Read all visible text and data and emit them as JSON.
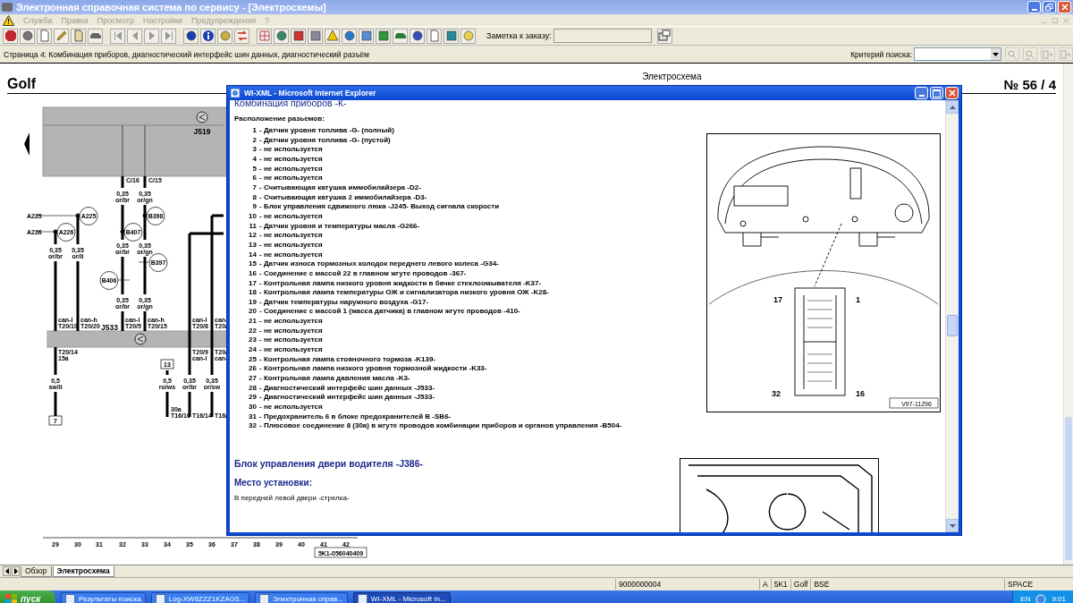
{
  "window": {
    "title": "Электронная справочная система по сервису - [Электросхемы]"
  },
  "menu": [
    "Служба",
    "Правка",
    "Просмотр",
    "Настройки",
    "Предупреждения",
    "?"
  ],
  "toolbar": {
    "note_label": "Заметка к заказу:"
  },
  "page_bar": {
    "page_text": "Страница 4: Комбинация приборов, диагностический интерфейс шин данных, диагностический разъём",
    "search_label": "Критерий поиска:"
  },
  "document": {
    "model": "Golf",
    "title": "Электросхема",
    "page_number": "№ 56 / 4",
    "part_number": "5K1-056040409",
    "column_numbers": [
      "29",
      "30",
      "31",
      "32",
      "33",
      "34",
      "35",
      "36",
      "37",
      "38",
      "39",
      "40",
      "41",
      "42"
    ],
    "schematic_labels": [
      {
        "kind": "unit",
        "text": "J519"
      },
      {
        "kind": "text",
        "text": "C/16"
      },
      {
        "kind": "text",
        "text": "C/15"
      },
      {
        "kind": "text",
        "text": "0,35"
      },
      {
        "kind": "text",
        "text": "or/br"
      },
      {
        "kind": "text",
        "text": "0,35"
      },
      {
        "kind": "text",
        "text": "or/gn"
      },
      {
        "kind": "text",
        "text": "A225"
      },
      {
        "kind": "circle",
        "text": "A225"
      },
      {
        "kind": "text",
        "text": "A226"
      },
      {
        "kind": "circle",
        "text": "A226"
      },
      {
        "kind": "circle",
        "text": "B398"
      },
      {
        "kind": "circle",
        "text": "B407"
      },
      {
        "kind": "text",
        "text": "0,35"
      },
      {
        "kind": "text",
        "text": "or/br"
      },
      {
        "kind": "text",
        "text": "0,35"
      },
      {
        "kind": "text",
        "text": "or/li"
      },
      {
        "kind": "text",
        "text": "0,35"
      },
      {
        "kind": "text",
        "text": "or/br"
      },
      {
        "kind": "text",
        "text": "0,35"
      },
      {
        "kind": "text",
        "text": "or/gn"
      },
      {
        "kind": "circle",
        "text": "B397"
      },
      {
        "kind": "circle",
        "text": "B406"
      },
      {
        "kind": "text",
        "text": "0,35"
      },
      {
        "kind": "text",
        "text": "or/br"
      },
      {
        "kind": "text",
        "text": "0,35"
      },
      {
        "kind": "text",
        "text": "or/gn"
      },
      {
        "kind": "text",
        "text": "can-l"
      },
      {
        "kind": "text",
        "text": "T20/10"
      },
      {
        "kind": "text",
        "text": "can-h"
      },
      {
        "kind": "text",
        "text": "T20/20"
      },
      {
        "kind": "unit",
        "text": "J533"
      },
      {
        "kind": "text",
        "text": "can-l"
      },
      {
        "kind": "text",
        "text": "T20/5"
      },
      {
        "kind": "text",
        "text": "can-h"
      },
      {
        "kind": "text",
        "text": "T20/15"
      },
      {
        "kind": "text",
        "text": "can-l"
      },
      {
        "kind": "text",
        "text": "T20/8"
      },
      {
        "kind": "text",
        "text": "can-"
      },
      {
        "kind": "text",
        "text": "T20/"
      },
      {
        "kind": "text",
        "text": "T20/14"
      },
      {
        "kind": "text",
        "text": "15a"
      },
      {
        "kind": "box",
        "text": "13"
      },
      {
        "kind": "text",
        "text": "T20/9"
      },
      {
        "kind": "text",
        "text": "can-l"
      },
      {
        "kind": "text",
        "text": "T20/"
      },
      {
        "kind": "text",
        "text": "can-"
      },
      {
        "kind": "text",
        "text": "0,5"
      },
      {
        "kind": "text",
        "text": "sw/li"
      },
      {
        "kind": "text",
        "text": "0,5"
      },
      {
        "kind": "text",
        "text": "ro/ws"
      },
      {
        "kind": "text",
        "text": "0,35"
      },
      {
        "kind": "text",
        "text": "or/br"
      },
      {
        "kind": "text",
        "text": "0,35"
      },
      {
        "kind": "text",
        "text": "or/sw"
      },
      {
        "kind": "text",
        "text": "30a"
      },
      {
        "kind": "text",
        "text": "T16/16"
      },
      {
        "kind": "text",
        "text": "T16/14"
      },
      {
        "kind": "text",
        "text": "T16/"
      },
      {
        "kind": "box",
        "text": "7"
      }
    ]
  },
  "popup": {
    "title": "WI-XML - Microsoft Internet Explorer",
    "heading": "Комбинация приборов -К-",
    "subheading": "Расположение разьемов:",
    "pins": [
      {
        "number": "1",
        "text": "- Датчик уровня топлива -G- (полный)"
      },
      {
        "number": "2",
        "text": "- Датчик уровня топлива -G- (пустой)"
      },
      {
        "number": "3",
        "text": "- не используется"
      },
      {
        "number": "4",
        "text": "- не используется"
      },
      {
        "number": "5",
        "text": "- не используется"
      },
      {
        "number": "6",
        "text": "- не используется"
      },
      {
        "number": "7",
        "text": "- Считывающая катушка иммобилайзера -D2-"
      },
      {
        "number": "8",
        "text": "- Считывающая катушка 2 иммобилайзера -D3-"
      },
      {
        "number": "9",
        "text": "- Блок управления сдвижного люка -J245- Выход сигнала скорости"
      },
      {
        "number": "10",
        "text": "- не используется"
      },
      {
        "number": "11",
        "text": "- Датчик уровня и температуры масла -G266-"
      },
      {
        "number": "12",
        "text": "- не используется"
      },
      {
        "number": "13",
        "text": "- не используется"
      },
      {
        "number": "14",
        "text": "- не используется"
      },
      {
        "number": "15",
        "text": "- Датчик износа тормозных колодок переднего левого колеса -G34-"
      },
      {
        "number": "16",
        "text": "- Соединение с массой 22 в главном жгуте проводов -367-"
      },
      {
        "number": "17",
        "text": "- Контрольная лампа низкого уровня жидкости в бачке стеклоомывателя -K37-"
      },
      {
        "number": "18",
        "text": "- Контрольная лампа температуры ОЖ и сигнализатора низкого уровня ОЖ -K28-"
      },
      {
        "number": "19",
        "text": "- Датчик температуры наружного воздуха -G17-"
      },
      {
        "number": "20",
        "text": "- Соединение с массой 1 (масса датчика) в главном жгуте проводов -410-"
      },
      {
        "number": "21",
        "text": "- не используется"
      },
      {
        "number": "22",
        "text": "- не используется"
      },
      {
        "number": "23",
        "text": "- не используется"
      },
      {
        "number": "24",
        "text": "- не используется"
      },
      {
        "number": "25",
        "text": "- Контрольная лампа стояночного тормоза -K139-"
      },
      {
        "number": "26",
        "text": "- Контрольная лампа низкого уровня тормозной жидкости -K33-"
      },
      {
        "number": "27",
        "text": "- Контрольная лампа давления масла -K3-"
      },
      {
        "number": "28",
        "text": "- Диагностический интерфейс шин данных -J533-"
      },
      {
        "number": "29",
        "text": "- Диагностический интерфейс шин данных -J533-"
      },
      {
        "number": "30",
        "text": "- не используется"
      },
      {
        "number": "31",
        "text": "- Предохранитель 6 в блоке предохранителей B -SB6-"
      },
      {
        "number": "32",
        "text": "- Плюсовое соединение 8 (30а) в жгуте проводов комбинации приборов и органов управления -B504-"
      }
    ],
    "figure_labels": [
      "17",
      "1",
      "32",
      "16"
    ],
    "figure_code": "V97-11296",
    "section_heading": "Блок управления двери водителя -J386-",
    "location_label": "Место установки:",
    "location_text": "В передней левой двери -стрелка-"
  },
  "sheet_tabs": [
    {
      "label": "Обзор",
      "selected": false
    },
    {
      "label": "Электросхема",
      "selected": true
    }
  ],
  "status_bar": [
    "9000000004",
    "A",
    "5K1",
    "Golf",
    "BSE",
    "SPACE"
  ],
  "taskbar": {
    "start": "пуск",
    "items": [
      {
        "label": "Результаты поиска",
        "selected": false
      },
      {
        "label": "Log-XW8ZZZ1KZAG5...",
        "selected": false
      },
      {
        "label": "Электронная справ...",
        "selected": false
      },
      {
        "label": "WI-XML - Microsoft In...",
        "selected": true
      }
    ],
    "language": "EN",
    "clock": "9:01"
  }
}
